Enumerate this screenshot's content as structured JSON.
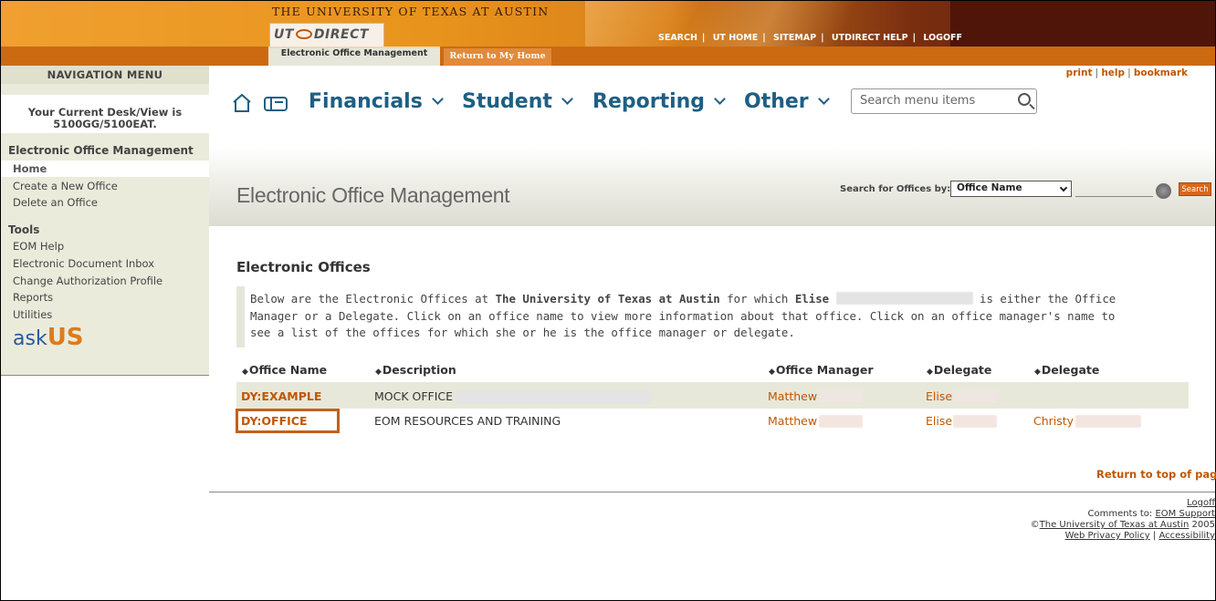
{
  "banner": {
    "university_title": "THE UNIVERSITY OF TEXAS AT AUSTIN",
    "logo_text_left": "UT",
    "logo_text_right": "DIRECT",
    "top_links": [
      "SEARCH",
      "UT HOME",
      "SITEMAP",
      "UTDIRECT HELP",
      "LOGOFF"
    ],
    "tab_active": "Electronic Office Management",
    "tab_home": "Return to My Home"
  },
  "nav": {
    "header": "NAVIGATION MENU",
    "desk_line1": "Your Current Desk/View is",
    "desk_line2": "5100GG/5100EAT.",
    "section_eom": "Electronic Office Management",
    "home": "Home",
    "create": "Create a New Office",
    "delete": "Delete an Office",
    "section_tools": "Tools",
    "tools": [
      "EOM Help",
      "Electronic Document Inbox",
      "Change Authorization Profile",
      "Reports",
      "Utilities"
    ],
    "askus_left": "ask",
    "askus_right": "US"
  },
  "util_links": {
    "print": "print",
    "help": "help",
    "bookmark": "bookmark"
  },
  "menu": {
    "items": [
      "Financials",
      "Student",
      "Reporting",
      "Other"
    ],
    "search_placeholder": "Search menu items"
  },
  "header": {
    "title": "Electronic Office Management",
    "search_label": "Search for Offices by:",
    "search_select": "Office Name",
    "search_button": "Search"
  },
  "content": {
    "section_title": "Electronic Offices",
    "intro_part1": "Below are the Electronic Offices at ",
    "intro_univ": "The University of Texas at Austin",
    "intro_part2": " for which ",
    "intro_name": "Elise",
    "intro_part3": " is either the Office",
    "intro_line2": "Manager or a Delegate. Click on an office name to view more information about that office. Click on an office manager's name to",
    "intro_line3": "see a list of the offices for which she or he is the office manager or delegate.",
    "columns": [
      "Office Name",
      "Description",
      "Office Manager",
      "Delegate",
      "Delegate"
    ],
    "rows": [
      {
        "office": "DY:EXAMPLE",
        "description": "MOCK OFFICE",
        "manager": "Matthew",
        "delegate1": "Elise",
        "delegate2": ""
      },
      {
        "office": "DY:OFFICE",
        "description": "EOM RESOURCES AND TRAINING",
        "manager": "Matthew",
        "delegate1": "Elise",
        "delegate2": "Christy"
      }
    ],
    "return_top": "Return to top of page"
  },
  "footer": {
    "logoff": "Logoff",
    "comments_label": "Comments to: ",
    "comments_link": "EOM Support",
    "copyright_symbol": "©",
    "copyright_link": "The University of Texas at Austin",
    "copyright_year": " 2005",
    "privacy": "Web Privacy Policy",
    "accessibility": "Accessibility"
  }
}
